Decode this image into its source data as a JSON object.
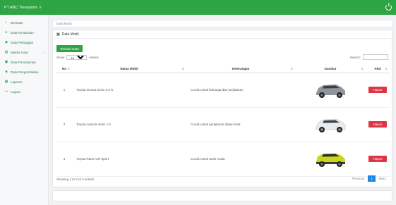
{
  "app": {
    "title": "PT.ABC Transports"
  },
  "sidebar": {
    "items": [
      {
        "label": "Beranda",
        "icon": "home-icon"
      },
      {
        "label": "Data Kendaraan",
        "icon": "user-icon"
      },
      {
        "label": "Data Pelanggan",
        "icon": "users-icon"
      },
      {
        "label": "Master Data",
        "icon": "list-icon"
      },
      {
        "label": "Data Peminjaman",
        "icon": "cart-icon"
      },
      {
        "label": "Data Pengembalian",
        "icon": "truck-icon"
      },
      {
        "label": "Laporan",
        "icon": "report-icon"
      },
      {
        "label": "Logout",
        "icon": "logout-icon"
      }
    ]
  },
  "breadcrumb": {
    "text": "Data Mobil"
  },
  "panel": {
    "title": "Data Mobil",
    "add_label": "Tambah Data",
    "show_label": "Show",
    "entries_label": "entries",
    "length_value": "10",
    "search_label": "Search:"
  },
  "table": {
    "headers": [
      "No",
      "Nama Mobil",
      "Keterangan",
      "Gambar",
      "Aksi"
    ],
    "rows": [
      {
        "no": "1",
        "nama": "Toyota Innova Zenix 2.0 G",
        "ket": "Cocok untuk keluarga dan perjalanan",
        "car": "silver",
        "aksi": "Hapus"
      },
      {
        "no": "2",
        "nama": "Toyota Avanza Veloz 1.5",
        "ket": "Cocok untuk perjalanan dalam kota",
        "car": "white",
        "aksi": "Hapus"
      },
      {
        "no": "3",
        "nama": "Toyota Raize GR Sport",
        "ket": "Cocok untuk anak muda",
        "car": "yellow",
        "aksi": "Hapus"
      }
    ]
  },
  "footer": {
    "info": "Showing 1 to 3 of 3 entries",
    "previous": "Previous",
    "page": "1",
    "next": "Next"
  },
  "colors": {
    "brand": "#2fa443",
    "danger": "#dc3545",
    "pager_active": "#1e88e5"
  }
}
